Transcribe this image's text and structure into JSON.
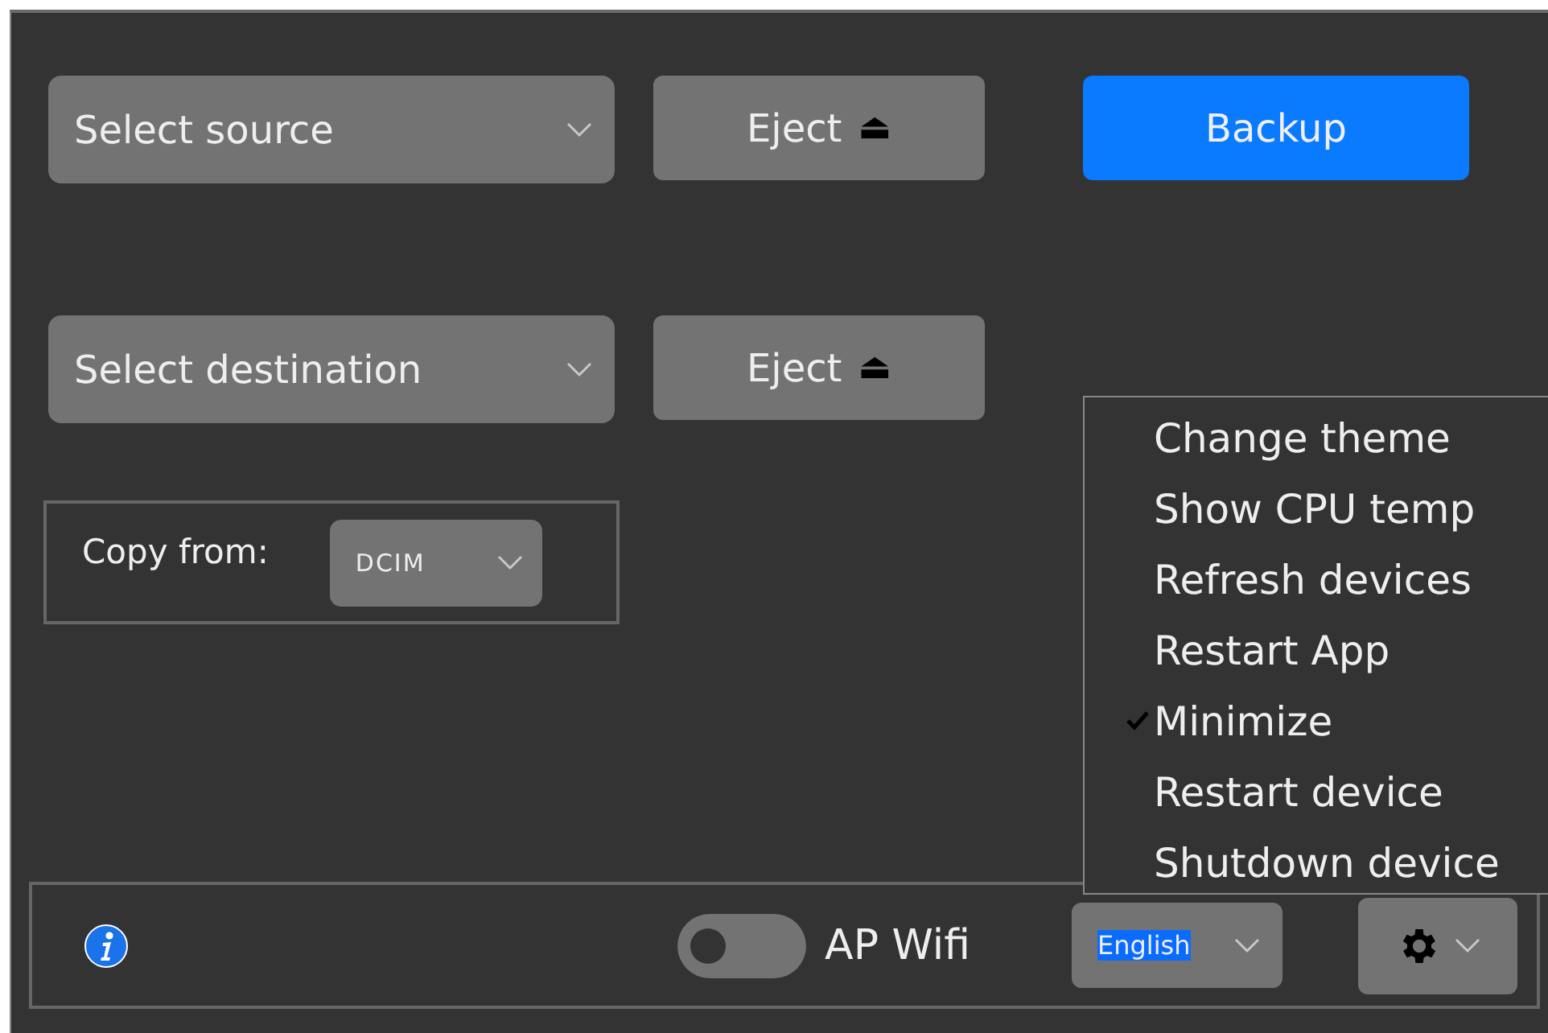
{
  "source": {
    "text": "Select source"
  },
  "source_eject": {
    "label": "Eject",
    "icon": "⏏"
  },
  "backup_button": {
    "label": "Backup"
  },
  "destination": {
    "text": "Select destination"
  },
  "destination_eject": {
    "label": "Eject",
    "icon": "⏏"
  },
  "copy_from": {
    "label": "Copy from:",
    "value": "DCIM"
  },
  "menu": {
    "items": [
      {
        "label": "Change theme",
        "checked": false
      },
      {
        "label": "Show CPU temp",
        "checked": false
      },
      {
        "label": "Refresh devices",
        "checked": false
      },
      {
        "label": "Restart App",
        "checked": false
      },
      {
        "label": "Minimize",
        "checked": true
      },
      {
        "label": "Restart device",
        "checked": false
      },
      {
        "label": "Shutdown device",
        "checked": false
      }
    ]
  },
  "bottom_bar": {
    "ap_wifi": {
      "label": "AP Wifi",
      "on": false
    },
    "language": {
      "value": "English",
      "text_selected": true
    }
  }
}
